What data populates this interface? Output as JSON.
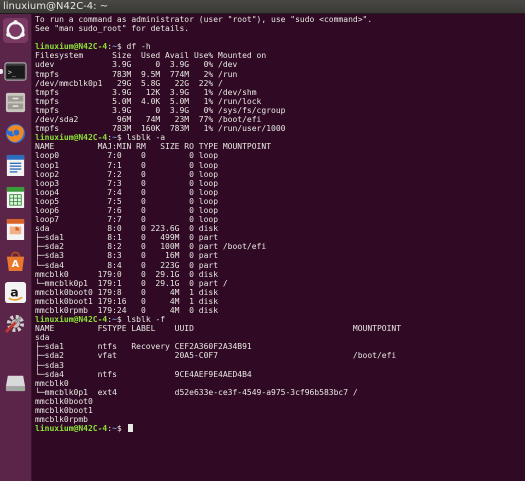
{
  "window": {
    "title": "linuxium@N42C-4: ~"
  },
  "launcher": {
    "items": [
      {
        "name": "dash-home",
        "icon": "ubuntu-logo-icon"
      },
      {
        "name": "terminal",
        "icon": "terminal-icon"
      },
      {
        "name": "files",
        "icon": "file-cabinet-icon"
      },
      {
        "name": "firefox",
        "icon": "firefox-icon"
      },
      {
        "name": "writer",
        "icon": "writer-document-icon"
      },
      {
        "name": "calc",
        "icon": "calc-spreadsheet-icon"
      },
      {
        "name": "impress",
        "icon": "impress-presentation-icon"
      },
      {
        "name": "software-center",
        "icon": "shopping-bag-icon"
      },
      {
        "name": "amazon",
        "icon": "amazon-icon"
      },
      {
        "name": "system-settings",
        "icon": "settings-gear-icon"
      },
      {
        "name": "drive",
        "icon": "disk-drive-icon"
      }
    ]
  },
  "colors": {
    "background": "#300a24",
    "prompt_user": "#8ae234",
    "prompt_path": "#729fcf",
    "text": "#e8e8e3"
  },
  "terminal": {
    "user_host": "linuxium@N42C-4",
    "path": "~",
    "lines": [
      {
        "type": "text",
        "text": "To run a command as administrator (user \"root\"), use \"sudo <command>\"."
      },
      {
        "type": "text",
        "text": "See \"man sudo_root\" for details."
      },
      {
        "type": "text",
        "text": ""
      },
      {
        "type": "prompt",
        "cmd": "df -h"
      },
      {
        "type": "text",
        "text": "Filesystem      Size  Used Avail Use% Mounted on"
      },
      {
        "type": "text",
        "text": "udev            3.9G     0  3.9G   0% /dev"
      },
      {
        "type": "text",
        "text": "tmpfs           783M  9.5M  774M   2% /run"
      },
      {
        "type": "text",
        "text": "/dev/mmcblk0p1   29G  5.8G   22G  22% /"
      },
      {
        "type": "text",
        "text": "tmpfs           3.9G   12K  3.9G   1% /dev/shm"
      },
      {
        "type": "text",
        "text": "tmpfs           5.0M  4.0K  5.0M   1% /run/lock"
      },
      {
        "type": "text",
        "text": "tmpfs           3.9G     0  3.9G   0% /sys/fs/cgroup"
      },
      {
        "type": "text",
        "text": "/dev/sda2        96M   74M   23M  77% /boot/efi"
      },
      {
        "type": "text",
        "text": "tmpfs           783M  160K  783M   1% /run/user/1000"
      },
      {
        "type": "prompt",
        "cmd": "lsblk -a"
      },
      {
        "type": "text",
        "text": "NAME         MAJ:MIN RM   SIZE RO TYPE MOUNTPOINT"
      },
      {
        "type": "text",
        "text": "loop0          7:0    0         0 loop"
      },
      {
        "type": "text",
        "text": "loop1          7:1    0         0 loop"
      },
      {
        "type": "text",
        "text": "loop2          7:2    0         0 loop"
      },
      {
        "type": "text",
        "text": "loop3          7:3    0         0 loop"
      },
      {
        "type": "text",
        "text": "loop4          7:4    0         0 loop"
      },
      {
        "type": "text",
        "text": "loop5          7:5    0         0 loop"
      },
      {
        "type": "text",
        "text": "loop6          7:6    0         0 loop"
      },
      {
        "type": "text",
        "text": "loop7          7:7    0         0 loop"
      },
      {
        "type": "text",
        "text": "sda            8:0    0 223.6G  0 disk"
      },
      {
        "type": "text",
        "text": "├─sda1         8:1    0   499M  0 part"
      },
      {
        "type": "text",
        "text": "├─sda2         8:2    0   100M  0 part /boot/efi"
      },
      {
        "type": "text",
        "text": "├─sda3         8:3    0    16M  0 part"
      },
      {
        "type": "text",
        "text": "└─sda4         8:4    0   223G  0 part"
      },
      {
        "type": "text",
        "text": "mmcblk0      179:0    0  29.1G  0 disk"
      },
      {
        "type": "text",
        "text": "└─mmcblk0p1  179:1    0  29.1G  0 part /"
      },
      {
        "type": "text",
        "text": "mmcblk0boot0 179:8    0     4M  1 disk"
      },
      {
        "type": "text",
        "text": "mmcblk0boot1 179:16   0     4M  1 disk"
      },
      {
        "type": "text",
        "text": "mmcblk0rpmb  179:24   0     4M  0 disk"
      },
      {
        "type": "prompt",
        "cmd": "lsblk -f"
      },
      {
        "type": "text",
        "text": "NAME         FSTYPE LABEL    UUID                                 MOUNTPOINT"
      },
      {
        "type": "text",
        "text": "sda"
      },
      {
        "type": "text",
        "text": "├─sda1       ntfs   Recovery CEF2A360F2A34B91"
      },
      {
        "type": "text",
        "text": "├─sda2       vfat            20A5-C0F7                            /boot/efi"
      },
      {
        "type": "text",
        "text": "├─sda3"
      },
      {
        "type": "text",
        "text": "└─sda4       ntfs            9CE4AEF9E4AED4B4"
      },
      {
        "type": "text",
        "text": "mmcblk0"
      },
      {
        "type": "text",
        "text": "└─mmcblk0p1  ext4            d52e633e-ce3f-4549-a975-3cf96b583bc7 /"
      },
      {
        "type": "text",
        "text": "mmcblk0boot0"
      },
      {
        "type": "text",
        "text": "mmcblk0boot1"
      },
      {
        "type": "text",
        "text": "mmcblk0rpmb"
      },
      {
        "type": "prompt",
        "cmd": "",
        "cursor": true
      }
    ]
  }
}
